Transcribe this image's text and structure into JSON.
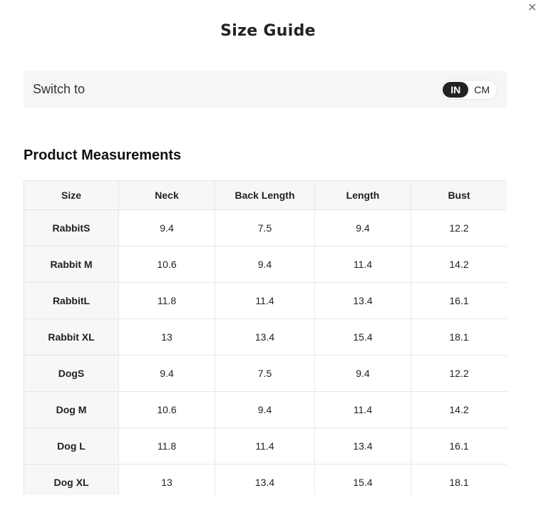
{
  "modal": {
    "close_glyph": "×",
    "title": "Size Guide"
  },
  "unit_switch": {
    "label": "Switch to",
    "options": [
      "IN",
      "CM"
    ],
    "selected": "IN"
  },
  "measurements": {
    "section_title": "Product Measurements",
    "columns": [
      "Size",
      "Neck",
      "Back Length",
      "Length",
      "Bust"
    ],
    "rows": [
      [
        "RabbitS",
        "9.4",
        "7.5",
        "9.4",
        "12.2"
      ],
      [
        "Rabbit M",
        "10.6",
        "9.4",
        "11.4",
        "14.2"
      ],
      [
        "RabbitL",
        "11.8",
        "11.4",
        "13.4",
        "16.1"
      ],
      [
        "Rabbit XL",
        "13",
        "13.4",
        "15.4",
        "18.1"
      ],
      [
        "DogS",
        "9.4",
        "7.5",
        "9.4",
        "12.2"
      ],
      [
        "Dog M",
        "10.6",
        "9.4",
        "11.4",
        "14.2"
      ],
      [
        "Dog L",
        "11.8",
        "11.4",
        "13.4",
        "16.1"
      ],
      [
        "Dog XL",
        "13",
        "13.4",
        "15.4",
        "18.1"
      ]
    ]
  },
  "colors": {
    "toggle_active_bg": "#222222",
    "header_bg": "#f7f7f7",
    "switch_bar_bg": "#f6f6f6"
  }
}
